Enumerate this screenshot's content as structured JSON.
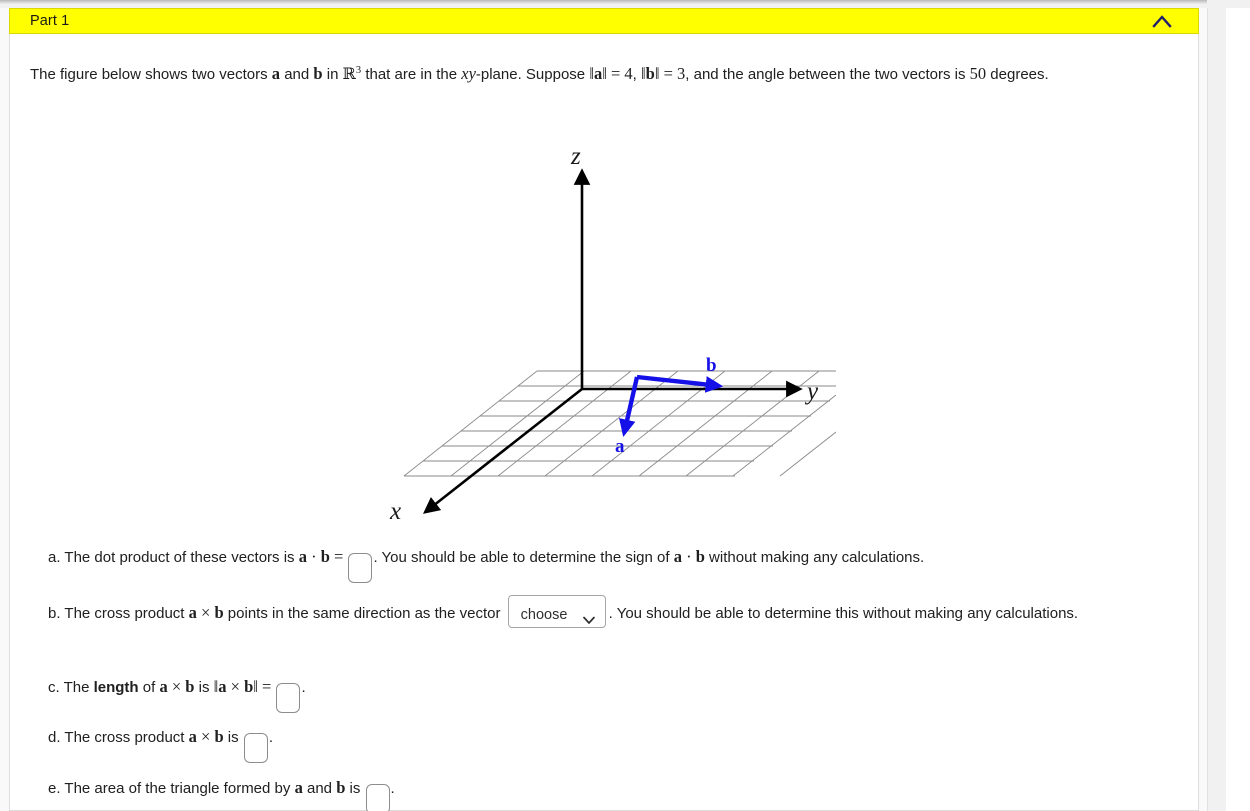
{
  "window": {
    "background": "#ffffff",
    "page_background": "#f9f9f9"
  },
  "part_header": {
    "title": "Part 1",
    "background_color": "#ffff00",
    "collapse_icon": "chevron-up-icon"
  },
  "prompt": {
    "text_1": "The figure below shows two vectors ",
    "vec_a": "a",
    "text_2": " and ",
    "vec_b": "b",
    "text_3": " in ",
    "space_symbol": "R",
    "space_exponent": "3",
    "text_4": " that are in the ",
    "plane_x": "x",
    "plane_y": "y",
    "text_5": "-plane. Suppose ",
    "norm_a_open": "‖",
    "norm_a_close": "‖",
    "eq_1": " = ",
    "norm_a_value": "4",
    "comma": ", ",
    "norm_b_value": "3",
    "text_6": ", and the angle between the two vectors is ",
    "angle_value": "50",
    "text_7": " degrees."
  },
  "figure": {
    "axis_labels": {
      "x": "x",
      "y": "y",
      "z": "z"
    },
    "vector_labels": {
      "a": "a",
      "b": "b"
    },
    "vector_color": "#1510e8",
    "axis_color": "#000000",
    "grid_color": "#8a8a8a",
    "background": "#ffffff",
    "description": "3D coordinate axes with a square grid on the xy-plane; two blue vectors a and b drawn from a common point in the plane"
  },
  "items": [
    {
      "id": "a",
      "marker": "a.",
      "segments": [
        {
          "type": "text",
          "value": "The dot product of these vectors is "
        },
        {
          "type": "mbf",
          "value": "a"
        },
        {
          "type": "op",
          "value": " · "
        },
        {
          "type": "mbf",
          "value": "b"
        },
        {
          "type": "op",
          "value": " = "
        },
        {
          "type": "input",
          "value": "",
          "name": "dot-product-input"
        },
        {
          "type": "text",
          "value": ". You should be able to determine the sign of "
        },
        {
          "type": "mbf",
          "value": "a"
        },
        {
          "type": "op",
          "value": " · "
        },
        {
          "type": "mbf",
          "value": "b"
        },
        {
          "type": "text",
          "value": " without making any calculations."
        }
      ]
    },
    {
      "id": "b",
      "marker": "b.",
      "segments": [
        {
          "type": "text",
          "value": "The cross product "
        },
        {
          "type": "mbf",
          "value": "a"
        },
        {
          "type": "op",
          "value": " × "
        },
        {
          "type": "mbf",
          "value": "b"
        },
        {
          "type": "text",
          "value": " points in the same direction as the vector "
        },
        {
          "type": "select",
          "value": "choose",
          "name": "direction-select"
        },
        {
          "type": "text",
          "value": ". You should be able to determine this without making any calculations."
        }
      ]
    },
    {
      "id": "c",
      "marker": "c.",
      "segments": [
        {
          "type": "text",
          "value": "The "
        },
        {
          "type": "bold",
          "value": "length"
        },
        {
          "type": "text",
          "value": " of "
        },
        {
          "type": "mbf",
          "value": "a"
        },
        {
          "type": "op",
          "value": " × "
        },
        {
          "type": "mbf",
          "value": "b"
        },
        {
          "type": "text",
          "value": " is "
        },
        {
          "type": "norm",
          "value": "‖a × b‖"
        },
        {
          "type": "op",
          "value": " = "
        },
        {
          "type": "input",
          "value": "",
          "name": "cross-length-input"
        },
        {
          "type": "text",
          "value": "."
        }
      ]
    },
    {
      "id": "d",
      "marker": "d.",
      "segments": [
        {
          "type": "text",
          "value": "The cross product "
        },
        {
          "type": "mbf",
          "value": "a"
        },
        {
          "type": "op",
          "value": " × "
        },
        {
          "type": "mbf",
          "value": "b"
        },
        {
          "type": "text",
          "value": " is "
        },
        {
          "type": "input",
          "value": "",
          "name": "cross-product-input"
        },
        {
          "type": "text",
          "value": "."
        }
      ]
    },
    {
      "id": "e",
      "marker": "e.",
      "segments": [
        {
          "type": "text",
          "value": "The area of the triangle formed by "
        },
        {
          "type": "mbf",
          "value": "a"
        },
        {
          "type": "text",
          "value": " and "
        },
        {
          "type": "mbf",
          "value": "b"
        },
        {
          "type": "text",
          "value": " is "
        },
        {
          "type": "input",
          "value": "",
          "name": "triangle-area-input"
        },
        {
          "type": "text",
          "value": "."
        }
      ]
    }
  ],
  "item_inputs": {
    "dot_product": "",
    "cross_length": "",
    "cross_product": "",
    "triangle_area": "",
    "direction_choice": "choose"
  }
}
